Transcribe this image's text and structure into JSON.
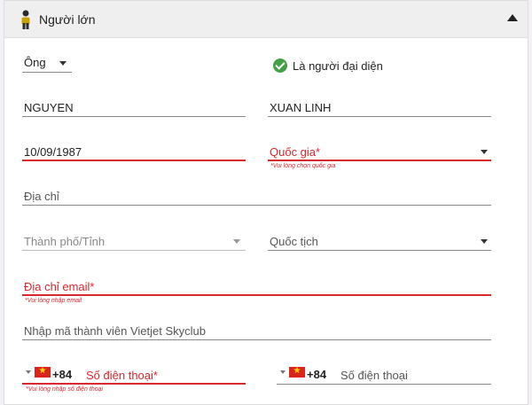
{
  "section": {
    "title": "Người lớn"
  },
  "title_select": {
    "value": "Ông"
  },
  "representative": {
    "label": "Là người đại diện"
  },
  "last_name": {
    "value": "NGUYEN"
  },
  "first_name": {
    "value": "XUAN LINH"
  },
  "birth_date": {
    "value": "10/09/1987"
  },
  "country": {
    "placeholder": "Quốc gia*",
    "error": "*Vui lòng chọn quốc gia"
  },
  "address": {
    "placeholder": "Địa chỉ"
  },
  "city": {
    "placeholder": "Thành phố/Tỉnh"
  },
  "nationality": {
    "placeholder": "Quốc tịch"
  },
  "email": {
    "placeholder": "Địa chỉ email*",
    "error": "*Vui lòng nhập email"
  },
  "member_code": {
    "placeholder": "Nhập mã thành viên Vietjet Skyclub"
  },
  "phone": {
    "country_code": "+84",
    "placeholder": "Số điện thoại*",
    "error": "*Vui lòng nhập số điện thoại"
  },
  "phone2": {
    "country_code": "+84",
    "placeholder": "Số điện thoại"
  },
  "colors": {
    "error": "#d9272e",
    "check": "#43a047",
    "flag_red": "#da251d",
    "flag_star": "#ffde00"
  },
  "icons": [
    "person-icon",
    "chevron-up-icon",
    "check-circle-icon",
    "dropdown-caret-icon",
    "vietnam-flag-icon"
  ]
}
